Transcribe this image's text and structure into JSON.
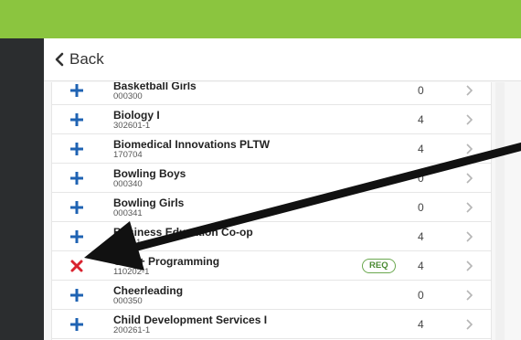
{
  "colors": {
    "topbar": "#8bc53f",
    "sidebar": "#2b2d2f",
    "add_icon": "#1f63b3",
    "remove_icon": "#d9232f",
    "req_badge": "#6aa84f"
  },
  "header": {
    "back_label": "Back"
  },
  "courses": [
    {
      "name": "Basketball Girls",
      "code": "000300",
      "credits": "0",
      "icon": "plus-icon"
    },
    {
      "name": "Biology I",
      "code": "302601-1",
      "credits": "4",
      "icon": "plus-icon"
    },
    {
      "name": "Biomedical Innovations PLTW",
      "code": "170704",
      "credits": "4",
      "icon": "plus-icon"
    },
    {
      "name": "Bowling Boys",
      "code": "000340",
      "credits": "0",
      "icon": "plus-icon"
    },
    {
      "name": "Bowling Girls",
      "code": "000341",
      "credits": "0",
      "icon": "plus-icon"
    },
    {
      "name": "Business Education Co-op",
      "code": "070111",
      "credits": "4",
      "icon": "plus-icon"
    },
    {
      "name": "C/C++ Programming",
      "code": "110202-1",
      "credits": "4",
      "icon": "remove-x-icon",
      "badge": "REQ"
    },
    {
      "name": "Cheerleading",
      "code": "000350",
      "credits": "0",
      "icon": "plus-icon"
    },
    {
      "name": "Child Development Services I",
      "code": "200261-1",
      "credits": "4",
      "icon": "plus-icon"
    }
  ]
}
